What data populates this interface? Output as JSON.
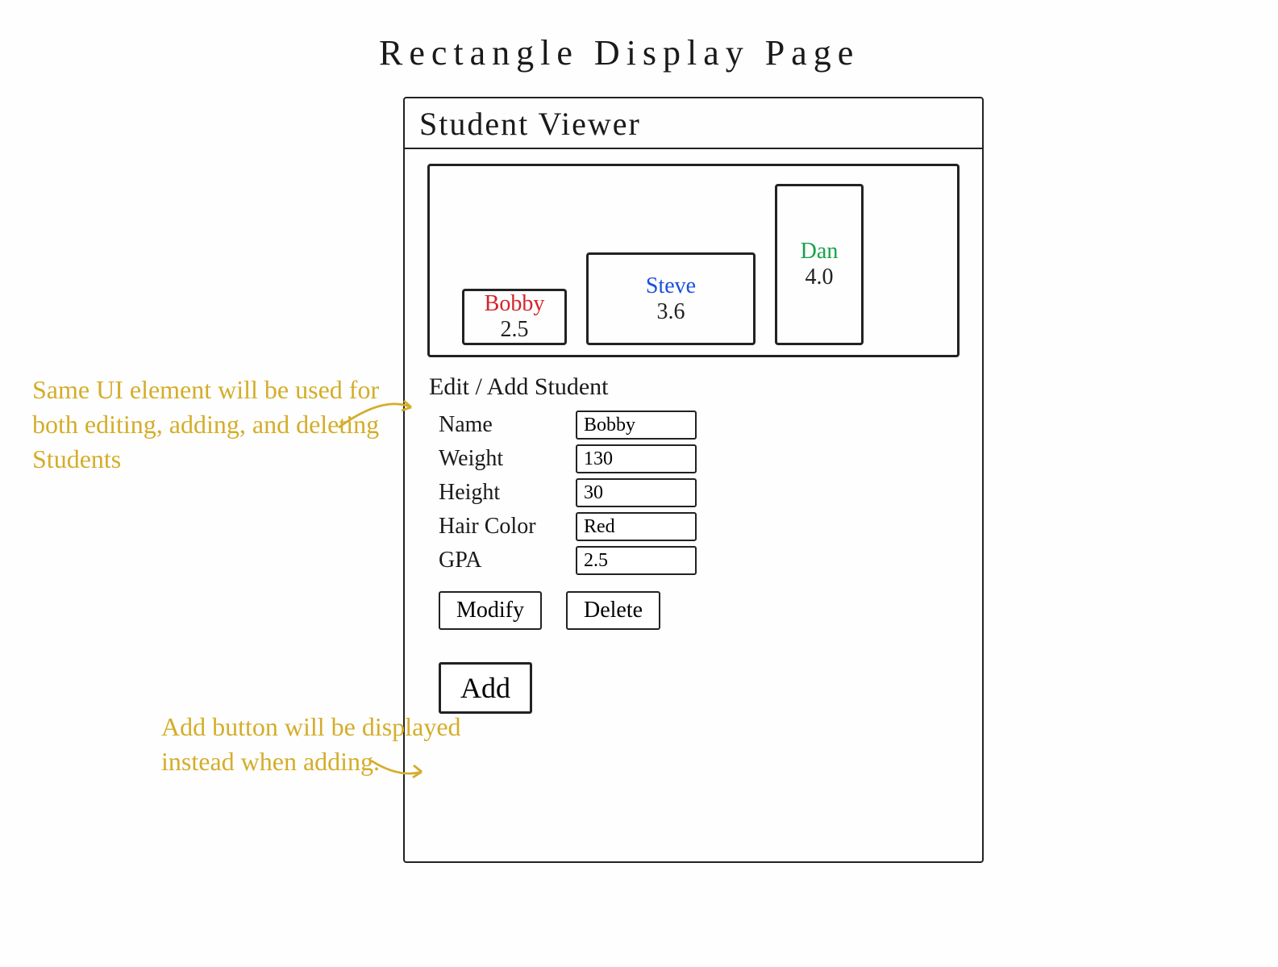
{
  "page_title": "Rectangle  Display  Page",
  "window_title": "Student Viewer",
  "students": [
    {
      "name": "Bobby",
      "gpa": "2.5",
      "color": "#d4232a"
    },
    {
      "name": "Steve",
      "gpa": "3.6",
      "color": "#1a4fdf"
    },
    {
      "name": "Dan",
      "gpa": "4.0",
      "color": "#14a34a"
    }
  ],
  "form": {
    "heading": "Edit / Add  Student",
    "fields": {
      "name": {
        "label": "Name",
        "value": "Bobby"
      },
      "weight": {
        "label": "Weight",
        "value": "130"
      },
      "height": {
        "label": "Height",
        "value": "30"
      },
      "hair_color": {
        "label": "Hair Color",
        "value": "Red"
      },
      "gpa": {
        "label": "GPA",
        "value": "2.5"
      }
    },
    "buttons": {
      "modify": "Modify",
      "delete": "Delete",
      "add": "Add"
    }
  },
  "annotations": {
    "shared_ui": "Same UI element will be used for both editing, adding, and deleting Students",
    "add_note": "Add button will be displayed instead when adding."
  }
}
